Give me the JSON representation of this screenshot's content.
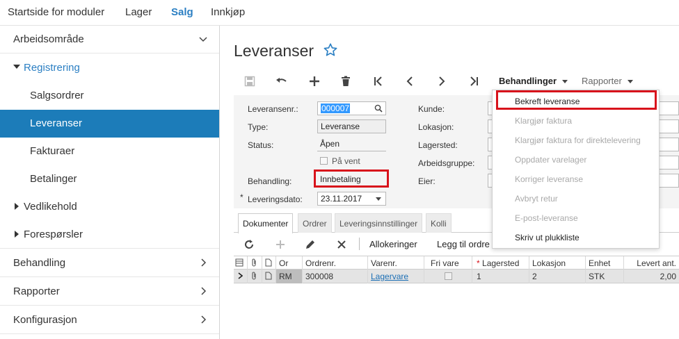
{
  "topnav": {
    "tabs": [
      "Startside for moduler",
      "Lager",
      "Salg",
      "Innkjøp"
    ]
  },
  "sidebar": {
    "items": [
      {
        "label": "Arbeidsområde"
      },
      {
        "label": "Registrering"
      },
      {
        "label": "Salgsordrer"
      },
      {
        "label": "Leveranser"
      },
      {
        "label": "Fakturaer"
      },
      {
        "label": "Betalinger"
      },
      {
        "label": "Vedlikehold"
      },
      {
        "label": "Forespørsler"
      },
      {
        "label": "Behandling"
      },
      {
        "label": "Rapporter"
      },
      {
        "label": "Konfigurasjon"
      }
    ]
  },
  "main": {
    "title": "Leveranser",
    "toolbar": {
      "behandlinger": "Behandlinger",
      "rapporter": "Rapporter"
    },
    "form": {
      "leveransenr_label": "Leveransenr.:",
      "leveransenr_value": "000007",
      "type_label": "Type:",
      "type_value": "Leveranse",
      "status_label": "Status:",
      "status_value": "Åpen",
      "paavent_label": "På vent",
      "behandling_label": "Behandling:",
      "behandling_value": "Innbetaling",
      "leveringsdato_star": "*",
      "leveringsdato_label": "Leveringsdato:",
      "leveringsdato_value": "23.11.2017",
      "kunde_label": "Kunde:",
      "lokasjon_label": "Lokasjon:",
      "lagersted_label": "Lagersted:",
      "arbeidsgruppe_label": "Arbeidsgruppe:",
      "eier_label": "Eier:"
    },
    "subtabs": [
      "Dokumenter",
      "Ordrer",
      "Leveringsinnstillinger",
      "Kolli"
    ],
    "gridbar": {
      "allokeringer": "Allokeringer",
      "legg_til": "Legg til ordre"
    },
    "grid": {
      "headers": [
        "Or",
        "Ordrenr.",
        "Varenr.",
        "Fri vare",
        "Lagersted",
        "Lokasjon",
        "Enhet",
        "Levert ant."
      ],
      "required_mark": "*",
      "row": [
        "RM",
        "300008",
        "Lagervare",
        "",
        "1",
        "2",
        "STK",
        "2,00"
      ]
    }
  },
  "menu": {
    "items": [
      "Bekreft leveranse",
      "Klargjør faktura",
      "Klargjør faktura for direktelevering",
      "Oppdater varelager",
      "Korriger leveranse",
      "Avbryt retur",
      "E-post-leveranse",
      "Skriv ut plukkliste"
    ]
  },
  "colors": {
    "accent": "#2b7fc3",
    "selected": "#1c7cb9",
    "highlight": "#d8121b"
  }
}
